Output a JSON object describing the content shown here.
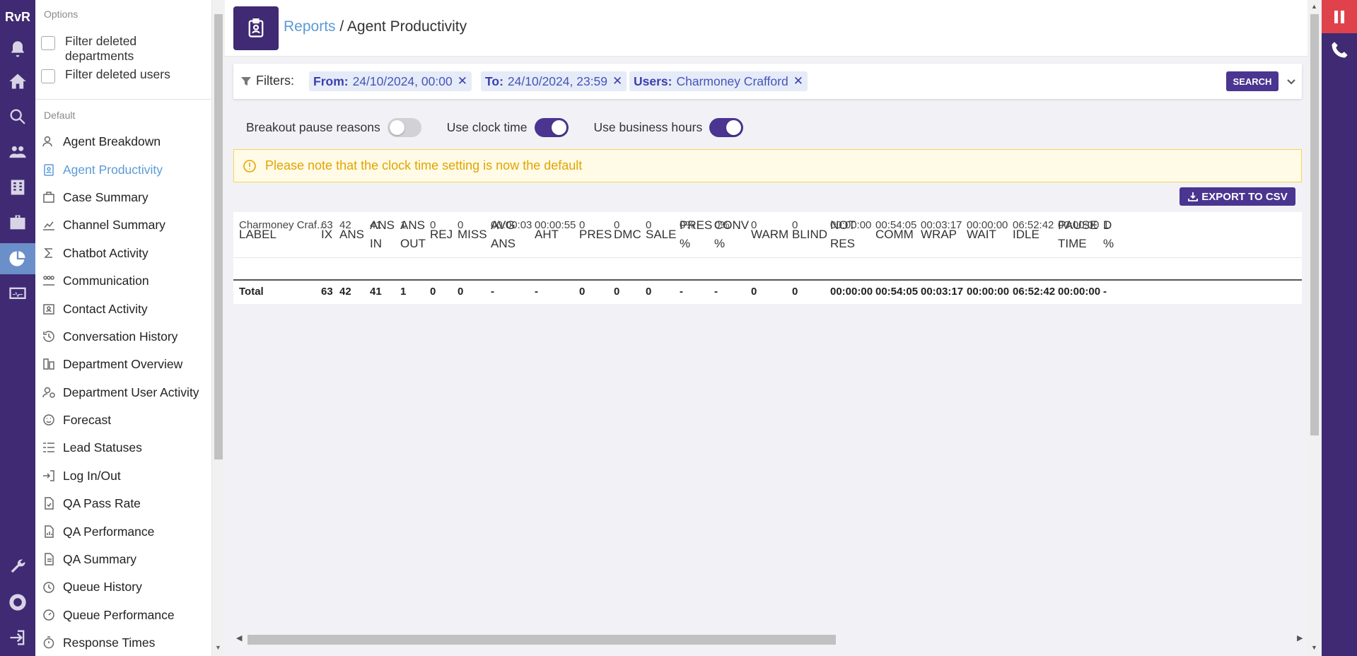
{
  "app": {
    "logo_text": "RvR"
  },
  "rail": {
    "icons": [
      "bell-icon",
      "home-icon",
      "search-icon",
      "users-icon",
      "building-icon",
      "briefcase-icon",
      "reports-icon",
      "monitor-icon",
      "wrench-icon",
      "help-icon",
      "logout-icon"
    ],
    "active": "reports-icon"
  },
  "panel": {
    "options_title": "Options",
    "options": [
      {
        "label": "Filter deleted departments",
        "checked": false
      },
      {
        "label": "Filter deleted users",
        "checked": false
      }
    ],
    "default_title": "Default",
    "reports": [
      {
        "label": "Agent Breakdown",
        "icon": "user-icon"
      },
      {
        "label": "Agent Productivity",
        "icon": "badge-icon",
        "active": true
      },
      {
        "label": "Case Summary",
        "icon": "case-icon"
      },
      {
        "label": "Channel Summary",
        "icon": "chart-icon"
      },
      {
        "label": "Chatbot Activity",
        "icon": "sigma-icon"
      },
      {
        "label": "Communication",
        "icon": "group-icon"
      },
      {
        "label": "Contact Activity",
        "icon": "contact-icon"
      },
      {
        "label": "Conversation History",
        "icon": "history-icon"
      },
      {
        "label": "Department Overview",
        "icon": "department-icon"
      },
      {
        "label": "Department User Activity",
        "icon": "user-activity-icon"
      },
      {
        "label": "Forecast",
        "icon": "forecast-icon"
      },
      {
        "label": "Lead Statuses",
        "icon": "list-icon"
      },
      {
        "label": "Log In/Out",
        "icon": "login-icon"
      },
      {
        "label": "QA Pass Rate",
        "icon": "doc-check-icon"
      },
      {
        "label": "QA Performance",
        "icon": "doc-chart-icon"
      },
      {
        "label": "QA Summary",
        "icon": "doc-icon"
      },
      {
        "label": "Queue History",
        "icon": "clock-icon"
      },
      {
        "label": "Queue Performance",
        "icon": "gauge-icon"
      },
      {
        "label": "Response Times",
        "icon": "stopwatch-icon"
      }
    ]
  },
  "header": {
    "breadcrumb_link": "Reports",
    "breadcrumb_sep": " / ",
    "breadcrumb_current": "Agent Productivity"
  },
  "filters": {
    "label": "Filters:",
    "chips": [
      {
        "key": "From:",
        "value": "24/10/2024, 00:00"
      },
      {
        "key": "To:",
        "value": "24/10/2024, 23:59"
      },
      {
        "key": "Users:",
        "value": "Charmoney Crafford"
      }
    ],
    "search_label": "SEARCH"
  },
  "toggles": [
    {
      "label": "Breakout pause reasons",
      "on": false
    },
    {
      "label": "Use clock time",
      "on": true
    },
    {
      "label": "Use business hours",
      "on": true
    }
  ],
  "notice": "Please note that the clock time setting is now the default",
  "export_label": "EXPORT TO CSV",
  "table": {
    "headers": [
      "LABEL",
      "IX",
      "ANS",
      "ANS IN",
      "ANS OUT",
      "REJ",
      "MISS",
      "AVG ANS",
      "AHT",
      "PRES",
      "DMC",
      "SALE",
      "PRES %",
      "CONV %",
      "WARM",
      "BLIND",
      "NOT RES",
      "COMM",
      "WRAP",
      "WAIT",
      "IDLE",
      "PAUSE TIME",
      "D %"
    ],
    "row": [
      "Charmoney Craf...",
      "63",
      "42",
      "41",
      "1",
      "0",
      "0",
      "00:00:03",
      "00:00:55",
      "0",
      "0",
      "0",
      "0%",
      "0%",
      "0",
      "0",
      "00:00:00",
      "00:54:05",
      "00:03:17",
      "00:00:00",
      "06:52:42",
      "00:00:00",
      "1"
    ],
    "total": [
      "Total",
      "63",
      "42",
      "41",
      "1",
      "0",
      "0",
      "-",
      "-",
      "0",
      "0",
      "0",
      "-",
      "-",
      "0",
      "0",
      "00:00:00",
      "00:54:05",
      "00:03:17",
      "00:00:00",
      "06:52:42",
      "00:00:00",
      "-"
    ]
  },
  "colors": {
    "brand": "#3f2a73",
    "accent": "#4a3590",
    "link": "#5b9bd5",
    "warning": "#e3a400",
    "alert": "#e0424c"
  }
}
